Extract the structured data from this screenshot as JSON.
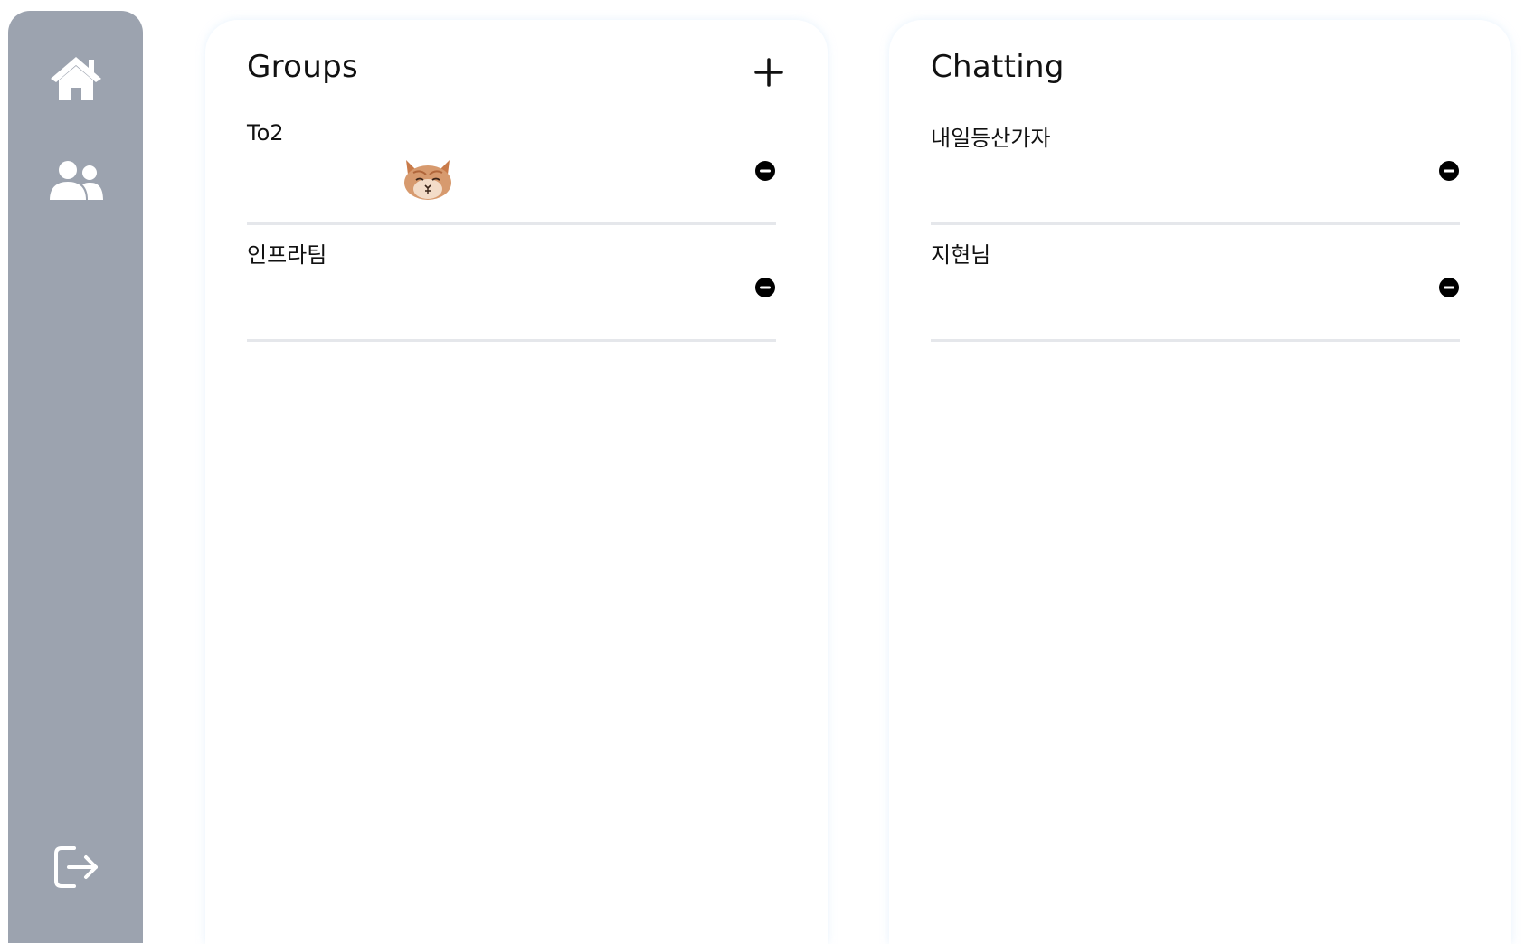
{
  "sidebar": {
    "home_icon": "home-icon",
    "friends_icon": "users-icon",
    "logout_icon": "logout-icon",
    "background_color": "#9ca3af"
  },
  "groups": {
    "title": "Groups",
    "add_icon": "plus-icon",
    "items": [
      {
        "name": "To2"
      },
      {
        "name": "인프라팀"
      }
    ]
  },
  "chatting": {
    "title": "Chatting",
    "items": [
      {
        "name": "내일등산가자"
      },
      {
        "name": "지현님"
      }
    ]
  }
}
